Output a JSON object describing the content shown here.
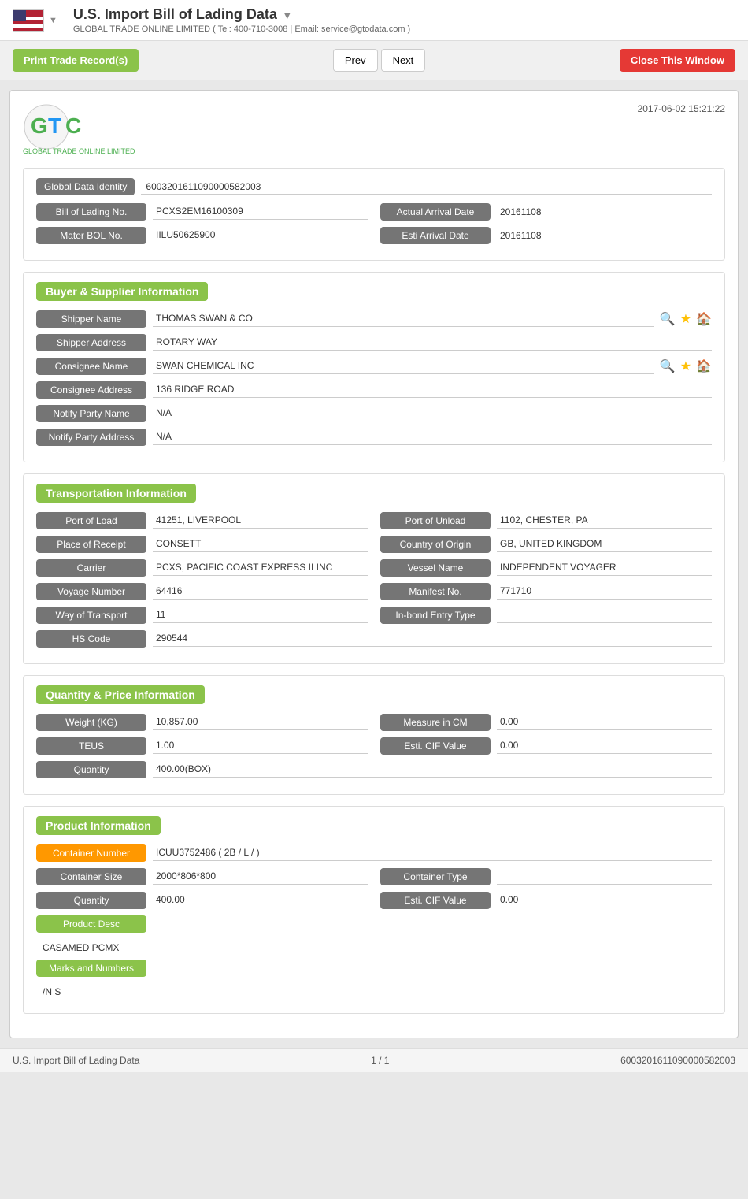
{
  "topbar": {
    "title": "U.S. Import Bill of Lading Data",
    "subtitle": "GLOBAL TRADE ONLINE LIMITED ( Tel: 400-710-3008 | Email: service@gtodata.com )"
  },
  "actions": {
    "print_label": "Print Trade Record(s)",
    "prev_label": "Prev",
    "next_label": "Next",
    "close_label": "Close This Window"
  },
  "logo": {
    "text": "GTO",
    "subtitle": "GLOBAL TRADE ONLINE LIMITED",
    "timestamp": "2017-06-02 15:21:22"
  },
  "global_data": {
    "label": "Global Data Identity",
    "value": "6003201611090000582003"
  },
  "bill_of_lading": {
    "bol_label": "Bill of Lading No.",
    "bol_value": "PCXS2EM16100309",
    "actual_arrival_label": "Actual Arrival Date",
    "actual_arrival_value": "20161108",
    "master_bol_label": "Mater BOL No.",
    "master_bol_value": "IILU50625900",
    "esti_arrival_label": "Esti Arrival Date",
    "esti_arrival_value": "20161108"
  },
  "buyer_supplier": {
    "section_title": "Buyer & Supplier Information",
    "shipper_name_label": "Shipper Name",
    "shipper_name_value": "THOMAS SWAN & CO",
    "shipper_address_label": "Shipper Address",
    "shipper_address_value": "ROTARY WAY",
    "consignee_name_label": "Consignee Name",
    "consignee_name_value": "SWAN CHEMICAL INC",
    "consignee_address_label": "Consignee Address",
    "consignee_address_value": "136 RIDGE ROAD",
    "notify_party_name_label": "Notify Party Name",
    "notify_party_name_value": "N/A",
    "notify_party_address_label": "Notify Party Address",
    "notify_party_address_value": "N/A"
  },
  "transportation": {
    "section_title": "Transportation Information",
    "port_of_load_label": "Port of Load",
    "port_of_load_value": "41251, LIVERPOOL",
    "port_of_unload_label": "Port of Unload",
    "port_of_unload_value": "1102, CHESTER, PA",
    "place_of_receipt_label": "Place of Receipt",
    "place_of_receipt_value": "CONSETT",
    "country_of_origin_label": "Country of Origin",
    "country_of_origin_value": "GB, UNITED KINGDOM",
    "carrier_label": "Carrier",
    "carrier_value": "PCXS, PACIFIC COAST EXPRESS II INC",
    "vessel_name_label": "Vessel Name",
    "vessel_name_value": "INDEPENDENT VOYAGER",
    "voyage_number_label": "Voyage Number",
    "voyage_number_value": "64416",
    "manifest_no_label": "Manifest No.",
    "manifest_no_value": "771710",
    "way_of_transport_label": "Way of Transport",
    "way_of_transport_value": "11",
    "inbond_entry_label": "In-bond Entry Type",
    "inbond_entry_value": "",
    "hs_code_label": "HS Code",
    "hs_code_value": "290544"
  },
  "quantity_price": {
    "section_title": "Quantity & Price Information",
    "weight_label": "Weight (KG)",
    "weight_value": "10,857.00",
    "measure_label": "Measure in CM",
    "measure_value": "0.00",
    "teus_label": "TEUS",
    "teus_value": "1.00",
    "esti_cif_label": "Esti. CIF Value",
    "esti_cif_value": "0.00",
    "quantity_label": "Quantity",
    "quantity_value": "400.00(BOX)"
  },
  "product_info": {
    "section_title": "Product Information",
    "container_number_label": "Container Number",
    "container_number_value": "ICUU3752486 ( 2B / L / )",
    "container_size_label": "Container Size",
    "container_size_value": "2000*806*800",
    "container_type_label": "Container Type",
    "container_type_value": "",
    "quantity_label": "Quantity",
    "quantity_value": "400.00",
    "esti_cif_label": "Esti. CIF Value",
    "esti_cif_value": "0.00",
    "product_desc_label": "Product Desc",
    "product_desc_value": "CASAMED PCMX",
    "marks_numbers_label": "Marks and Numbers",
    "marks_numbers_value": "/N S"
  },
  "footer": {
    "left": "U.S. Import Bill of Lading Data",
    "center": "1 / 1",
    "right": "6003201611090000582003"
  }
}
